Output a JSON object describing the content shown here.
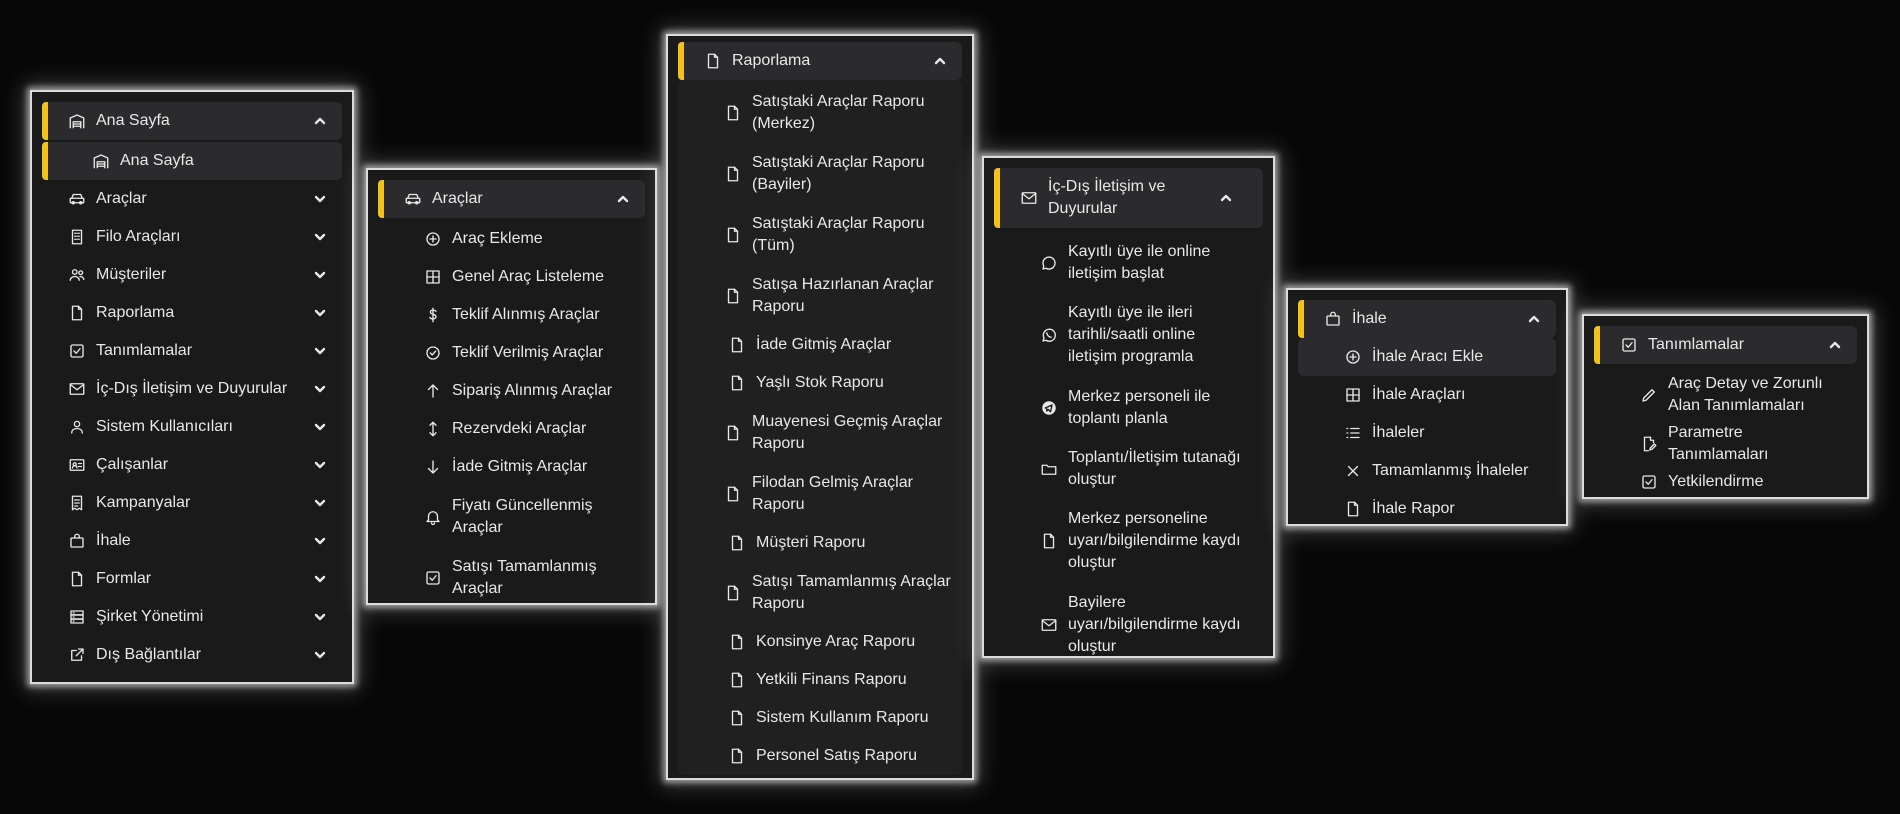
{
  "colors": {
    "accent": "#f2c21b",
    "panel_bg": "#1a1a1b",
    "active_bg": "#2b2b2d",
    "page_bg": "#070707"
  },
  "panel1": {
    "head": {
      "icon": "warehouse-icon",
      "label": "Ana Sayfa"
    },
    "active_sub": {
      "icon": "warehouse-icon",
      "label": "Ana Sayfa"
    },
    "items": [
      {
        "icon": "car-icon",
        "label": "Araçlar"
      },
      {
        "icon": "building-icon",
        "label": "Filo Araçları"
      },
      {
        "icon": "users-icon",
        "label": "Müşteriler"
      },
      {
        "icon": "file-icon",
        "label": "Raporlama"
      },
      {
        "icon": "check-square-icon",
        "label": "Tanımlamalar"
      },
      {
        "icon": "mail-icon",
        "label": "İç-Dış İletişim ve Duyurular"
      },
      {
        "icon": "user-icon",
        "label": "Sistem Kullanıcıları"
      },
      {
        "icon": "id-card-icon",
        "label": "Çalışanlar"
      },
      {
        "icon": "receipt-icon",
        "label": "Kampanyalar"
      },
      {
        "icon": "shopping-bag-icon",
        "label": "İhale"
      },
      {
        "icon": "file-icon",
        "label": "Formlar"
      },
      {
        "icon": "server-icon",
        "label": "Şirket Yönetimi"
      },
      {
        "icon": "external-link-icon",
        "label": "Dış Bağlantılar"
      }
    ]
  },
  "panel2": {
    "head": {
      "icon": "car-icon",
      "label": "Araçlar"
    },
    "items": [
      {
        "icon": "plus-circle-icon",
        "label": "Araç Ekleme"
      },
      {
        "icon": "grid-icon",
        "label": "Genel Araç Listeleme"
      },
      {
        "icon": "dollar-icon",
        "label": "Teklif Alınmış Araçlar"
      },
      {
        "icon": "check-circle-icon",
        "label": "Teklif Verilmiş Araçlar"
      },
      {
        "icon": "arrow-up-icon",
        "label": "Sipariş Alınmış Araçlar"
      },
      {
        "icon": "arrows-vertical-icon",
        "label": "Rezervdeki Araçlar"
      },
      {
        "icon": "arrow-down-icon",
        "label": "İade Gitmiş Araçlar"
      },
      {
        "icon": "bell-icon",
        "label": "Fiyatı Güncellenmiş Araçlar"
      },
      {
        "icon": "check-square-icon",
        "label": "Satışı Tamamlanmış Araçlar"
      }
    ]
  },
  "panel3": {
    "head": {
      "icon": "file-icon",
      "label": "Raporlama"
    },
    "items": [
      {
        "icon": "file-icon",
        "label": "Satıştaki Araçlar Raporu (Merkez)"
      },
      {
        "icon": "file-icon",
        "label": "Satıştaki Araçlar Raporu (Bayiler)"
      },
      {
        "icon": "file-icon",
        "label": "Satıştaki Araçlar Raporu (Tüm)"
      },
      {
        "icon": "file-icon",
        "label": "Satışa Hazırlanan Araçlar Raporu"
      },
      {
        "icon": "file-icon",
        "label": "İade Gitmiş Araçlar"
      },
      {
        "icon": "file-icon",
        "label": "Yaşlı Stok Raporu"
      },
      {
        "icon": "file-icon",
        "label": "Muayenesi Geçmiş Araçlar Raporu"
      },
      {
        "icon": "file-icon",
        "label": "Filodan Gelmiş Araçlar Raporu"
      },
      {
        "icon": "file-icon",
        "label": "Müşteri Raporu"
      },
      {
        "icon": "file-icon",
        "label": "Satışı Tamamlanmış Araçlar Raporu"
      },
      {
        "icon": "file-icon",
        "label": "Konsinye Araç Raporu"
      },
      {
        "icon": "file-icon",
        "label": "Yetkili Finans Raporu"
      },
      {
        "icon": "file-icon",
        "label": "Sistem Kullanım Raporu"
      },
      {
        "icon": "file-icon",
        "label": "Personel Satış Raporu"
      }
    ]
  },
  "panel4": {
    "head": {
      "icon": "mail-icon",
      "label": "İç-Dış İletişim ve Duyurular"
    },
    "items": [
      {
        "icon": "message-icon",
        "label": "Kayıtlı üye ile online iletişim başlat"
      },
      {
        "icon": "whatsapp-icon",
        "label": "Kayıtlı üye ile ileri tarihli/saatli online iletişim programla"
      },
      {
        "icon": "telegram-icon",
        "label": "Merkez personeli ile toplantı planla"
      },
      {
        "icon": "folder-icon",
        "label": "Toplantı/İletişim tutanağı oluştur"
      },
      {
        "icon": "file-icon",
        "label": "Merkez personeline uyarı/bilgilendirme kaydı oluştur"
      },
      {
        "icon": "mail-icon",
        "label": "Bayilere uyarı/bilgilendirme kaydı oluştur"
      }
    ]
  },
  "panel5": {
    "head": {
      "icon": "shopping-bag-icon",
      "label": "İhale"
    },
    "items": [
      {
        "icon": "plus-circle-icon",
        "label": "İhale Aracı Ekle"
      },
      {
        "icon": "grid-icon",
        "label": "İhale Araçları"
      },
      {
        "icon": "list-icon",
        "label": "İhaleler"
      },
      {
        "icon": "x-icon",
        "label": "Tamamlanmış İhaleler"
      },
      {
        "icon": "file-icon",
        "label": "İhale Rapor"
      }
    ]
  },
  "panel6": {
    "head": {
      "icon": "check-square-icon",
      "label": "Tanımlamalar"
    },
    "items": [
      {
        "icon": "pencil-icon",
        "label": "Araç Detay ve Zorunlı Alan Tanımlamaları"
      },
      {
        "icon": "file-edit-icon",
        "label": "Parametre Tanımlamaları"
      },
      {
        "icon": "check-square-icon",
        "label": "Yetkilendirme"
      }
    ]
  }
}
